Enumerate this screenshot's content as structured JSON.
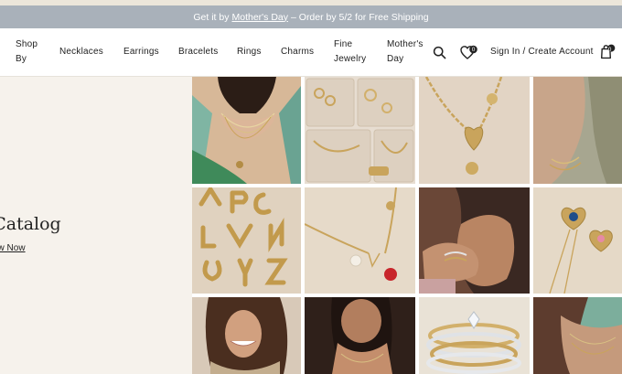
{
  "promo": {
    "prefix": "Get it by",
    "link": "Mother's Day",
    "suffix": "– Order by 5/2 for Free Shipping"
  },
  "nav": {
    "items": [
      {
        "line1": "Shop",
        "line2": "By"
      },
      {
        "line1": "Necklaces"
      },
      {
        "line1": "Earrings"
      },
      {
        "line1": "Bracelets"
      },
      {
        "line1": "Rings"
      },
      {
        "line1": "Charms"
      },
      {
        "line1": "Fine",
        "line2": "Jewelry"
      },
      {
        "line1": "Mother's",
        "line2": "Day"
      }
    ],
    "account": "Sign In / Create Account",
    "wishlist_count": "0",
    "cart_count": "0"
  },
  "hero": {
    "title": "g Catalog",
    "cta": "ow Now"
  },
  "grid": {
    "tiles": [
      "model-layered-necklaces",
      "jewelry-tray",
      "heart-charm-chain",
      "wrist-bracelets",
      "gold-letter-charms",
      "pearl-red-charm-necklace",
      "model-stacked-rings",
      "heart-gemstone-earrings",
      "model-smiling",
      "model-neckline",
      "diamond-rings-stack",
      "model-pendant"
    ]
  },
  "colors": {
    "promo_bg": "#a9b1ba",
    "hero_bg": "#f6f2ec",
    "gold": "#c9a45c"
  }
}
